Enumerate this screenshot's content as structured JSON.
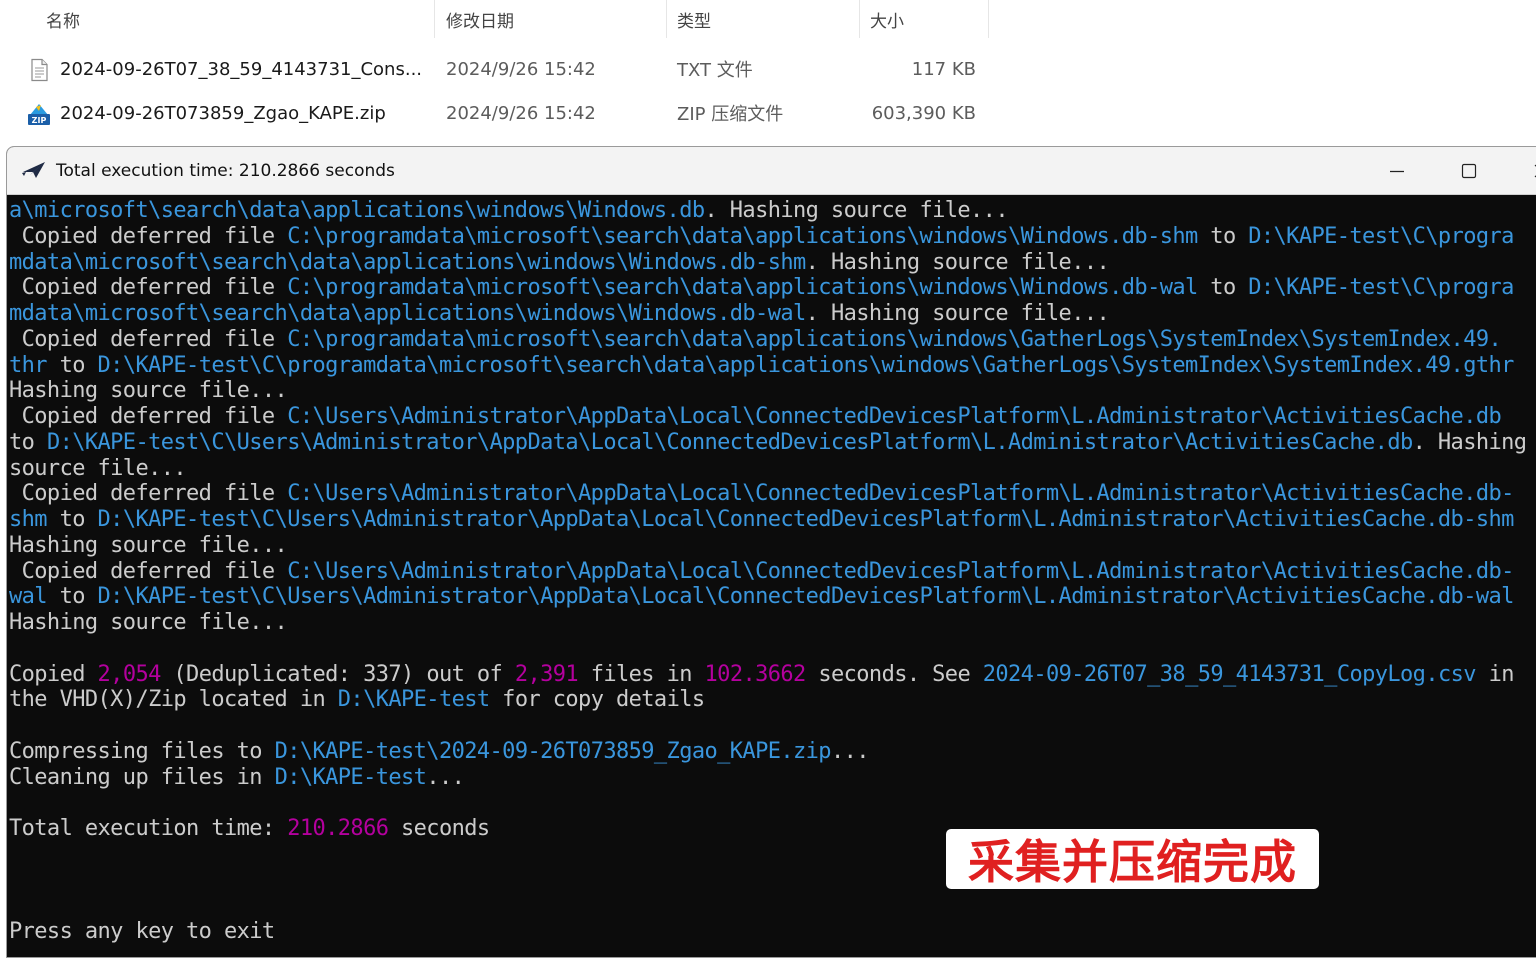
{
  "explorer": {
    "columns": {
      "name": "名称",
      "modified": "修改日期",
      "type": "类型",
      "size": "大小"
    },
    "files": [
      {
        "name": "2024-09-26T07_38_59_4143731_Cons...",
        "modified": "2024/9/26 15:42",
        "type": "TXT 文件",
        "size": "117 KB",
        "icon": "text-file-icon"
      },
      {
        "name": "2024-09-26T073859_Zgao_KAPE.zip",
        "modified": "2024/9/26 15:42",
        "type": "ZIP 压缩文件",
        "size": "603,390 KB",
        "icon": "zip-file-icon"
      }
    ]
  },
  "console_window": {
    "title": "Total execution time: 210.2866 seconds",
    "icon": "kape-app-icon",
    "lines": [
      [
        [
          "c",
          "a\\microsoft\\search\\data\\applications\\windows\\Windows.db"
        ],
        [
          "w",
          ". Hashing source file..."
        ]
      ],
      [
        [
          "w",
          " Copied deferred file "
        ],
        [
          "c",
          "C:\\programdata\\microsoft\\search\\data\\applications\\windows\\Windows.db-shm"
        ],
        [
          "w",
          " to "
        ],
        [
          "c",
          "D:\\KAPE-test\\C\\progra"
        ]
      ],
      [
        [
          "c",
          "mdata\\microsoft\\search\\data\\applications\\windows\\Windows.db-shm"
        ],
        [
          "w",
          ". Hashing source file..."
        ]
      ],
      [
        [
          "w",
          " Copied deferred file "
        ],
        [
          "c",
          "C:\\programdata\\microsoft\\search\\data\\applications\\windows\\Windows.db-wal"
        ],
        [
          "w",
          " to "
        ],
        [
          "c",
          "D:\\KAPE-test\\C\\progra"
        ]
      ],
      [
        [
          "c",
          "mdata\\microsoft\\search\\data\\applications\\windows\\Windows.db-wal"
        ],
        [
          "w",
          ". Hashing source file..."
        ]
      ],
      [
        [
          "w",
          " Copied deferred file "
        ],
        [
          "c",
          "C:\\programdata\\microsoft\\search\\data\\applications\\windows\\GatherLogs\\SystemIndex\\SystemIndex.49."
        ]
      ],
      [
        [
          "c",
          "thr"
        ],
        [
          "w",
          " to "
        ],
        [
          "c",
          "D:\\KAPE-test\\C\\programdata\\microsoft\\search\\data\\applications\\windows\\GatherLogs\\SystemIndex\\SystemIndex.49.gthr"
        ]
      ],
      [
        [
          "w",
          "Hashing source file..."
        ]
      ],
      [
        [
          "w",
          " Copied deferred file "
        ],
        [
          "c",
          "C:\\Users\\Administrator\\AppData\\Local\\ConnectedDevicesPlatform\\L.Administrator\\ActivitiesCache.db"
        ]
      ],
      [
        [
          "w",
          "to "
        ],
        [
          "c",
          "D:\\KAPE-test\\C\\Users\\Administrator\\AppData\\Local\\ConnectedDevicesPlatform\\L.Administrator\\ActivitiesCache.db"
        ],
        [
          "w",
          ". Hashing"
        ]
      ],
      [
        [
          "w",
          "source file..."
        ]
      ],
      [
        [
          "w",
          " Copied deferred file "
        ],
        [
          "c",
          "C:\\Users\\Administrator\\AppData\\Local\\ConnectedDevicesPlatform\\L.Administrator\\ActivitiesCache.db-"
        ]
      ],
      [
        [
          "c",
          "shm"
        ],
        [
          "w",
          " to "
        ],
        [
          "c",
          "D:\\KAPE-test\\C\\Users\\Administrator\\AppData\\Local\\ConnectedDevicesPlatform\\L.Administrator\\ActivitiesCache.db-shm"
        ]
      ],
      [
        [
          "w",
          "Hashing source file..."
        ]
      ],
      [
        [
          "w",
          " Copied deferred file "
        ],
        [
          "c",
          "C:\\Users\\Administrator\\AppData\\Local\\ConnectedDevicesPlatform\\L.Administrator\\ActivitiesCache.db-"
        ]
      ],
      [
        [
          "c",
          "wal"
        ],
        [
          "w",
          " to "
        ],
        [
          "c",
          "D:\\KAPE-test\\C\\Users\\Administrator\\AppData\\Local\\ConnectedDevicesPlatform\\L.Administrator\\ActivitiesCache.db-wal"
        ]
      ],
      [
        [
          "w",
          "Hashing source file..."
        ]
      ],
      [],
      [
        [
          "w",
          "Copied "
        ],
        [
          "m",
          "2,054"
        ],
        [
          "w",
          " (Deduplicated: 337) out of "
        ],
        [
          "m",
          "2,391"
        ],
        [
          "w",
          " files in "
        ],
        [
          "m",
          "102.3662"
        ],
        [
          "w",
          " seconds. See "
        ],
        [
          "c",
          "2024-09-26T07_38_59_4143731_CopyLog.csv"
        ],
        [
          "w",
          " in"
        ]
      ],
      [
        [
          "w",
          "the VHD(X)/Zip located in "
        ],
        [
          "c",
          "D:\\KAPE-test"
        ],
        [
          "w",
          " for copy details"
        ]
      ],
      [],
      [
        [
          "w",
          "Compressing files to "
        ],
        [
          "c",
          "D:\\KAPE-test\\2024-09-26T073859_Zgao_KAPE.zip"
        ],
        [
          "w",
          "..."
        ]
      ],
      [
        [
          "w",
          "Cleaning up files in "
        ],
        [
          "c",
          "D:\\KAPE-test"
        ],
        [
          "w",
          "..."
        ]
      ],
      [],
      [
        [
          "w",
          "Total execution time: "
        ],
        [
          "m",
          "210.2866"
        ],
        [
          "w",
          " seconds"
        ]
      ],
      [],
      [],
      [],
      [
        [
          "w",
          "Press any key to exit"
        ]
      ]
    ]
  },
  "overlay_label": "采集并压缩完成",
  "colors": {
    "console_bg": "#0c0c0c",
    "console_text": "#cccccc",
    "path_cyan": "#3a96dd",
    "number_magenta": "#b4009e",
    "label_red": "#e02020"
  }
}
